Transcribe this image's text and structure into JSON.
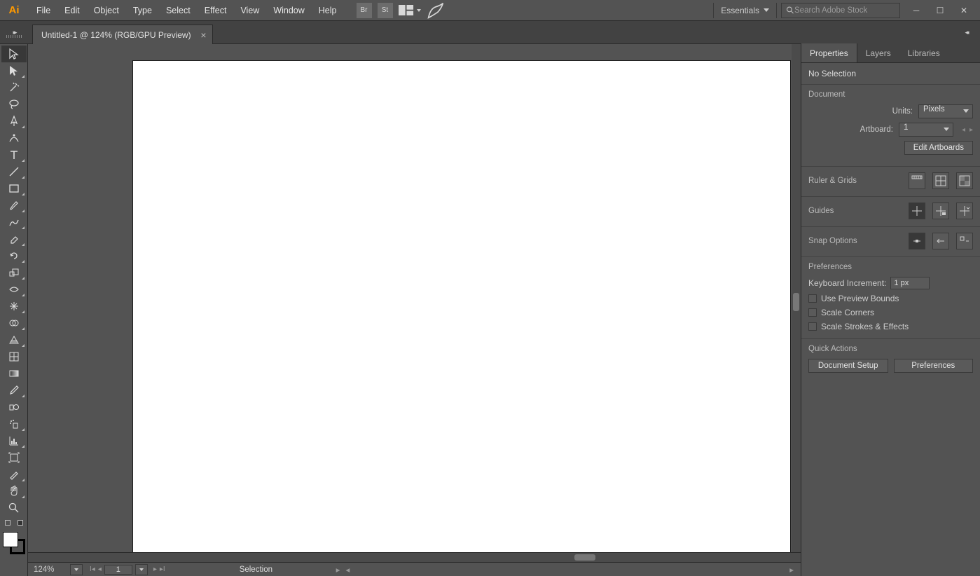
{
  "logo": "Ai",
  "menus": [
    "File",
    "Edit",
    "Object",
    "Type",
    "Select",
    "Effect",
    "View",
    "Window",
    "Help"
  ],
  "mb_icons": [
    "Br",
    "St"
  ],
  "workspace": "Essentials",
  "search_placeholder": "Search Adobe Stock",
  "doc_tab": "Untitled-1 @ 124% (RGB/GPU Preview)",
  "status": {
    "zoom": "124%",
    "artboard_nav": "1",
    "tool": "Selection"
  },
  "right_tabs": [
    "Properties",
    "Layers",
    "Libraries"
  ],
  "no_selection": "No Selection",
  "sections": {
    "document": {
      "title": "Document",
      "units_label": "Units:",
      "units_value": "Pixels",
      "artboard_label": "Artboard:",
      "artboard_value": "1",
      "edit_btn": "Edit Artboards"
    },
    "ruler": {
      "title": "Ruler & Grids"
    },
    "guides": {
      "title": "Guides"
    },
    "snap": {
      "title": "Snap Options"
    },
    "prefs": {
      "title": "Preferences",
      "ki_label": "Keyboard Increment:",
      "ki_value": "1 px",
      "cb1": "Use Preview Bounds",
      "cb2": "Scale Corners",
      "cb3": "Scale Strokes & Effects"
    },
    "quick": {
      "title": "Quick Actions",
      "btn1": "Document Setup",
      "btn2": "Preferences"
    }
  },
  "tools": [
    "selection",
    "direct-selection",
    "magic-wand",
    "lasso",
    "pen",
    "curvature",
    "type",
    "line",
    "rectangle",
    "paintbrush",
    "pencil",
    "eraser",
    "rotate",
    "scale",
    "width",
    "free-transform",
    "shape-builder",
    "perspective",
    "mesh",
    "gradient",
    "eyedropper",
    "blend",
    "symbol-sprayer",
    "column-graph",
    "artboard",
    "slice",
    "hand",
    "zoom"
  ]
}
